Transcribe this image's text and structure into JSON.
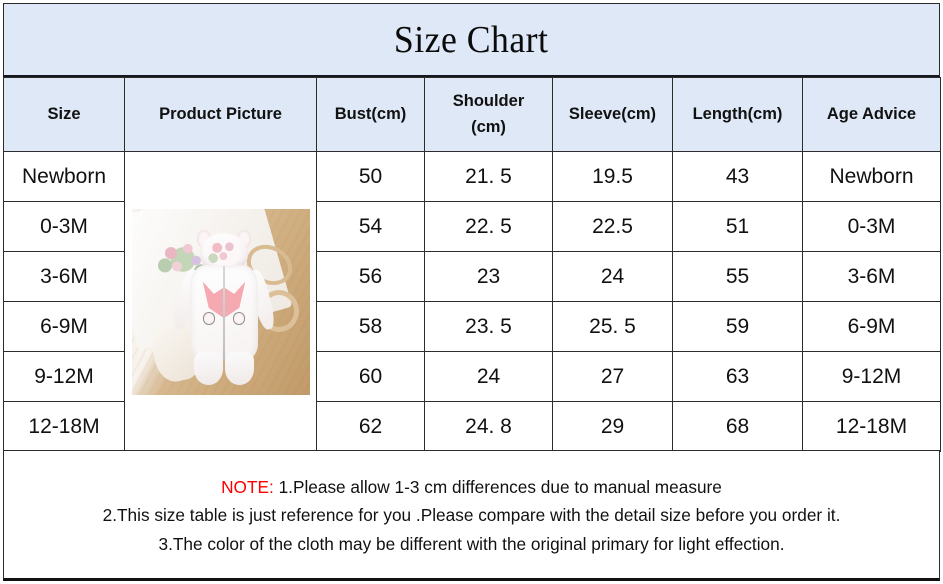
{
  "title": "Size Chart",
  "table": {
    "headers": [
      "Size",
      "Product Picture",
      "Bust(cm)",
      "Shoulder\n(cm)",
      "Sleeve(cm)",
      "Length(cm)",
      "Age Advice"
    ],
    "header_shoulder_line1": "Shoulder",
    "header_shoulder_line2": "(cm)",
    "rows": [
      {
        "size": "Newborn",
        "bust": "50",
        "shoulder": "21. 5",
        "sleeve": "19.5",
        "length": "43",
        "age": "Newborn"
      },
      {
        "size": "0-3M",
        "bust": "54",
        "shoulder": "22. 5",
        "sleeve": "22.5",
        "length": "51",
        "age": "0-3M"
      },
      {
        "size": "3-6M",
        "bust": "56",
        "shoulder": "23",
        "sleeve": "24",
        "length": "55",
        "age": "3-6M"
      },
      {
        "size": "6-9M",
        "bust": "58",
        "shoulder": "23. 5",
        "sleeve": "25. 5",
        "length": "59",
        "age": "6-9M"
      },
      {
        "size": "9-12M",
        "bust": "60",
        "shoulder": "24",
        "sleeve": "27",
        "length": "63",
        "age": "9-12M"
      },
      {
        "size": "12-18M",
        "bust": "62",
        "shoulder": "24. 8",
        "sleeve": "29",
        "length": "68",
        "age": "12-18M"
      }
    ],
    "product_image_alt": "baby fox hooded romper on wooden background"
  },
  "note": {
    "label": "NOTE:",
    "line1_rest": " 1.Please allow 1-3 cm differences due to manual measure",
    "line2": "2.This size table is just reference for you .Please compare with the detail size before you order  it.",
    "line3": "3.The color of the cloth may be different with the original primary for light effection."
  },
  "colors": {
    "header_background": "#dee8f6",
    "note_label": "#fe0000",
    "border": "#2c2c2c",
    "text": "#111111"
  }
}
